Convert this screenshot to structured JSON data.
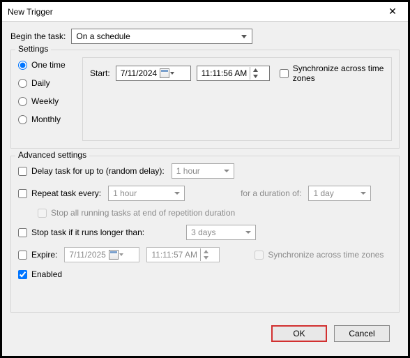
{
  "window": {
    "title": "New Trigger"
  },
  "begin": {
    "label": "Begin the task:",
    "value": "On a schedule"
  },
  "settings": {
    "legend": "Settings",
    "radios": {
      "one_time": "One time",
      "daily": "Daily",
      "weekly": "Weekly",
      "monthly": "Monthly",
      "selected": "one_time"
    },
    "start_label": "Start:",
    "date": "7/11/2024",
    "time": "11:11:56 AM",
    "sync_label": "Synchronize across time zones"
  },
  "advanced": {
    "legend": "Advanced settings",
    "delay_label": "Delay task for up to (random delay):",
    "delay_value": "1 hour",
    "repeat_label": "Repeat task every:",
    "repeat_value": "1 hour",
    "duration_label": "for a duration of:",
    "duration_value": "1 day",
    "stop_repetition_label": "Stop all running tasks at end of repetition duration",
    "stop_longer_label": "Stop task if it runs longer than:",
    "stop_longer_value": "3 days",
    "expire_label": "Expire:",
    "expire_date": "7/11/2025",
    "expire_time": "11:11:57 AM",
    "expire_sync_label": "Synchronize across time zones",
    "enabled_label": "Enabled"
  },
  "buttons": {
    "ok": "OK",
    "cancel": "Cancel"
  }
}
